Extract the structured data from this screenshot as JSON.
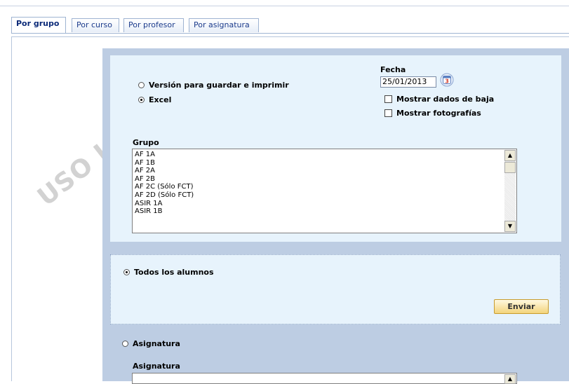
{
  "tabs": [
    {
      "label": "Por grupo",
      "active": true
    },
    {
      "label": "Por curso",
      "active": false
    },
    {
      "label": "Por profesor",
      "active": false
    },
    {
      "label": "Por asignatura",
      "active": false
    }
  ],
  "watermark": "USO I",
  "format_options": {
    "print_label": "Versión para guardar e imprimir",
    "excel_label": "Excel",
    "selected": "Excel"
  },
  "fecha": {
    "label": "Fecha",
    "value": "25/01/2013",
    "calendar_icon": "calendar-icon",
    "calendar_day": "3"
  },
  "checkboxes": {
    "baja_label": "Mostrar dados de baja",
    "fotos_label": "Mostrar fotografías"
  },
  "grupo": {
    "label": "Grupo",
    "items": [
      "AF 1A",
      "AF 1B",
      "AF 2A",
      "AF 2B",
      "AF 2C (Sólo FCT)",
      "AF 2D (Sólo FCT)",
      "ASIR 1A",
      "ASIR 1B"
    ]
  },
  "alumnos": {
    "todos_label": "Todos los alumnos",
    "send_label": "Enviar"
  },
  "asignatura": {
    "radio_label": "Asignatura",
    "field_label": "Asignatura"
  },
  "colors": {
    "panel": "#bdcde3",
    "box": "#e7f3fc",
    "button": "#f3d47c"
  }
}
